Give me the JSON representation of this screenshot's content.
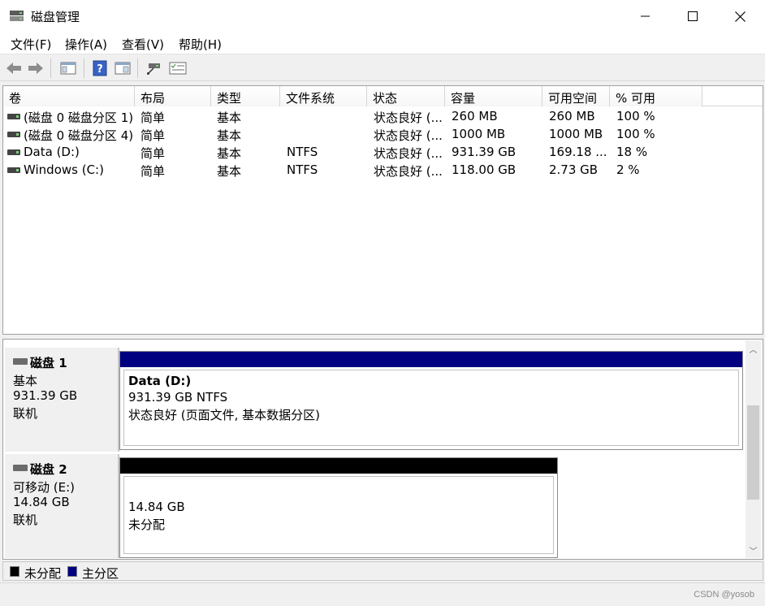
{
  "window": {
    "title": "磁盘管理"
  },
  "menu": [
    {
      "label": "文件(F)"
    },
    {
      "label": "操作(A)"
    },
    {
      "label": "查看(V)"
    },
    {
      "label": "帮助(H)"
    }
  ],
  "toolbar": {
    "icons": [
      "back-icon",
      "forward-icon",
      "console-tree-icon",
      "help-icon",
      "properties-icon",
      "connect-icon",
      "settings-list-icon"
    ]
  },
  "volume_list": {
    "columns": [
      "卷",
      "布局",
      "类型",
      "文件系统",
      "状态",
      "容量",
      "可用空间",
      "% 可用"
    ],
    "rows": [
      {
        "volume": "(磁盘 0 磁盘分区 1)",
        "layout": "简单",
        "type": "基本",
        "fs": "",
        "status": "状态良好 (...",
        "capacity": "260 MB",
        "free": "260 MB",
        "pct": "100 %"
      },
      {
        "volume": "(磁盘 0 磁盘分区 4)",
        "layout": "简单",
        "type": "基本",
        "fs": "",
        "status": "状态良好 (...",
        "capacity": "1000 MB",
        "free": "1000 MB",
        "pct": "100 %"
      },
      {
        "volume": "Data (D:)",
        "layout": "简单",
        "type": "基本",
        "fs": "NTFS",
        "status": "状态良好 (...",
        "capacity": "931.39 GB",
        "free": "169.18 ...",
        "pct": "18 %"
      },
      {
        "volume": "Windows (C:)",
        "layout": "简单",
        "type": "基本",
        "fs": "NTFS",
        "status": "状态良好 (...",
        "capacity": "118.00 GB",
        "free": "2.73 GB",
        "pct": "2 %"
      }
    ]
  },
  "disks": [
    {
      "name": "磁盘 1",
      "type": "基本",
      "size": "931.39 GB",
      "state": "联机",
      "partition": {
        "title": "Data  (D:)",
        "line1": "931.39 GB NTFS",
        "line2": "状态良好 (页面文件, 基本数据分区)",
        "bar_color": "#000080"
      }
    },
    {
      "name": "磁盘 2",
      "type": "可移动 (E:)",
      "size": "14.84 GB",
      "state": "联机",
      "partition": {
        "title": "",
        "line1": "14.84 GB",
        "line2": "未分配",
        "bar_color": "#000000"
      }
    }
  ],
  "legend": [
    {
      "label": "未分配",
      "color": "#000000"
    },
    {
      "label": "主分区",
      "color": "#000080"
    }
  ],
  "watermark": "CSDN @yosob"
}
